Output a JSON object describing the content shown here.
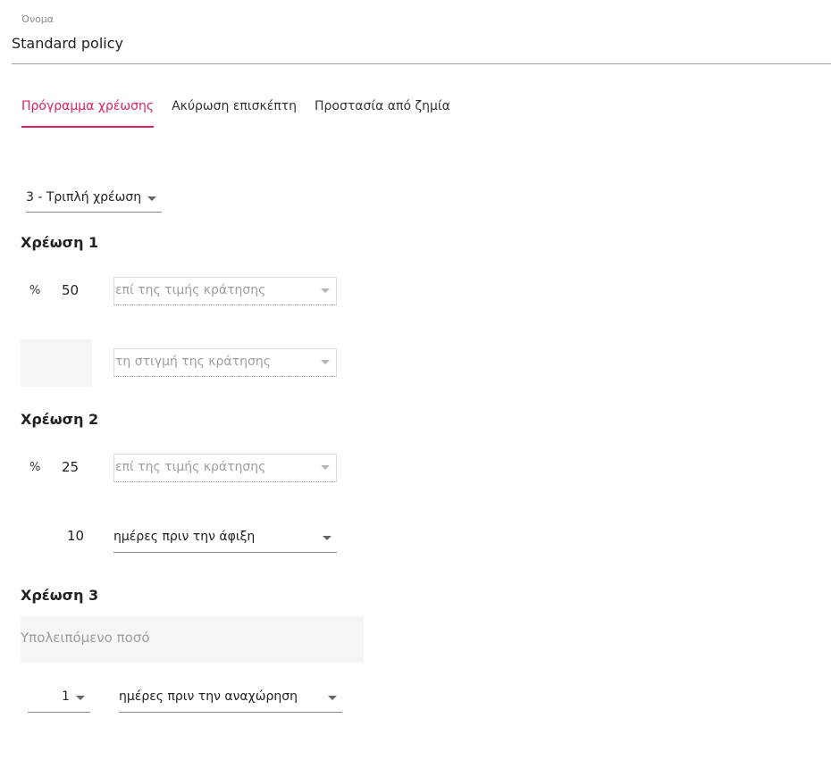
{
  "name_field": {
    "label": "Όνομα",
    "value": "Standard policy"
  },
  "tabs": [
    {
      "label": "Πρόγραμμα χρέωσης",
      "active": true
    },
    {
      "label": "Ακύρωση επισκέπτη",
      "active": false
    },
    {
      "label": "Προστασία από ζημία",
      "active": false
    }
  ],
  "charge_type_select": {
    "value": "3 - Τριπλή χρέωση"
  },
  "charge1": {
    "heading": "Χρέωση 1",
    "percent_symbol": "%",
    "percent_value": "50",
    "basis_select": "επί της τιμής κράτησης",
    "timing_select": "τη στιγμή της κράτησης"
  },
  "charge2": {
    "heading": "Χρέωση 2",
    "percent_symbol": "%",
    "percent_value": "25",
    "basis_select": "επί της τιμής κράτησης",
    "days_value": "10",
    "timing_select": "ημέρες πριν την άφιξη"
  },
  "charge3": {
    "heading": "Χρέωση 3",
    "remaining_label": "Υπολειπόμενο ποσό",
    "days_select": "1",
    "timing_select": "ημέρες πριν την αναχώρηση"
  },
  "colors": {
    "accent": "#e0205e",
    "disabled_text": "#9e9e9e",
    "panel_bg": "#f5f5f5"
  }
}
